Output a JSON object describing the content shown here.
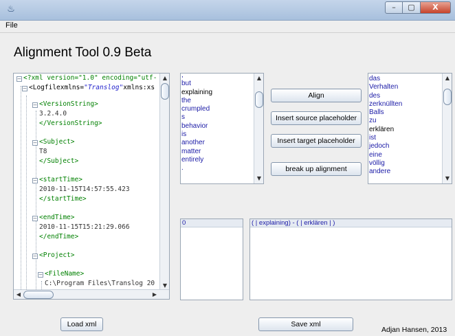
{
  "window": {
    "title": "",
    "controls": {
      "minimize": "–",
      "maximize": "▢",
      "close": "X"
    }
  },
  "menu": {
    "file": "File"
  },
  "page_title": "Alignment Tool 0.9 Beta",
  "xml_tree": {
    "lines": [
      {
        "parts": [
          {
            "t": "<?xml version=\"1.0\" encoding=\"utf-",
            "c": "tg"
          }
        ]
      },
      {
        "parts": [
          {
            "t": "<Logfile",
            "c": "tgb"
          },
          {
            "t": "xmlns=",
            "c": "tgb"
          },
          {
            "t": "\"Translog\"",
            "c": "str"
          },
          {
            "t": "xmlns:xs",
            "c": "tgb"
          }
        ]
      },
      {
        "parts": [
          {
            "t": "<VersionString>",
            "c": "tg"
          }
        ]
      },
      {
        "parts": [
          {
            "t": "3.2.4.0",
            "c": "txt"
          }
        ]
      },
      {
        "parts": [
          {
            "t": "</VersionString>",
            "c": "tg"
          }
        ]
      },
      {
        "parts": [
          {
            "t": "<Subject>",
            "c": "tg"
          }
        ]
      },
      {
        "parts": [
          {
            "t": "T8",
            "c": "txt"
          }
        ]
      },
      {
        "parts": [
          {
            "t": "</Subject>",
            "c": "tg"
          }
        ]
      },
      {
        "parts": [
          {
            "t": "<startTime>",
            "c": "tg"
          }
        ]
      },
      {
        "parts": [
          {
            "t": "2010-11-15T14:57:55.423",
            "c": "txt"
          }
        ]
      },
      {
        "parts": [
          {
            "t": "</startTime>",
            "c": "tg"
          }
        ]
      },
      {
        "parts": [
          {
            "t": "<endTime>",
            "c": "tg"
          }
        ]
      },
      {
        "parts": [
          {
            "t": "2010-11-15T15:21:29.066",
            "c": "txt"
          }
        ]
      },
      {
        "parts": [
          {
            "t": "</endTime>",
            "c": "tg"
          }
        ]
      },
      {
        "parts": [
          {
            "t": "<Project>",
            "c": "tg"
          }
        ]
      },
      {
        "parts": [
          {
            "t": "<FileName>",
            "c": "tg"
          }
        ]
      },
      {
        "parts": [
          {
            "t": "C:\\Program Files\\Translog 20",
            "c": "txt"
          }
        ]
      }
    ]
  },
  "source_words": {
    "items": [
      ",",
      "but",
      "explaining",
      "the",
      "crumpled",
      "s",
      "behavior",
      "is",
      "another",
      "matter",
      "entirely",
      "."
    ],
    "selected": "explaining"
  },
  "target_words": {
    "items": [
      "das",
      "Verhalten",
      "des",
      "zerknüllten",
      "Balls",
      "zu",
      "erklären",
      "ist",
      "jedoch",
      "eine",
      "völlig",
      "andere"
    ],
    "selected": "erklären"
  },
  "buttons": {
    "align": "Align",
    "insert_source": "Insert source placeholder",
    "insert_target": "Insert target placeholder",
    "break_up": "break up alignment",
    "load_xml": "Load xml",
    "save_xml": "Save xml"
  },
  "alignment_index": {
    "value": "0"
  },
  "alignments": {
    "first": "( | explaining) - ( | erklären | )"
  },
  "credit": "Adjan Hansen, 2013",
  "colors": {
    "link_blue": "#1a1aa6",
    "xml_tag": "#008000",
    "xml_string": "#2222cc"
  }
}
